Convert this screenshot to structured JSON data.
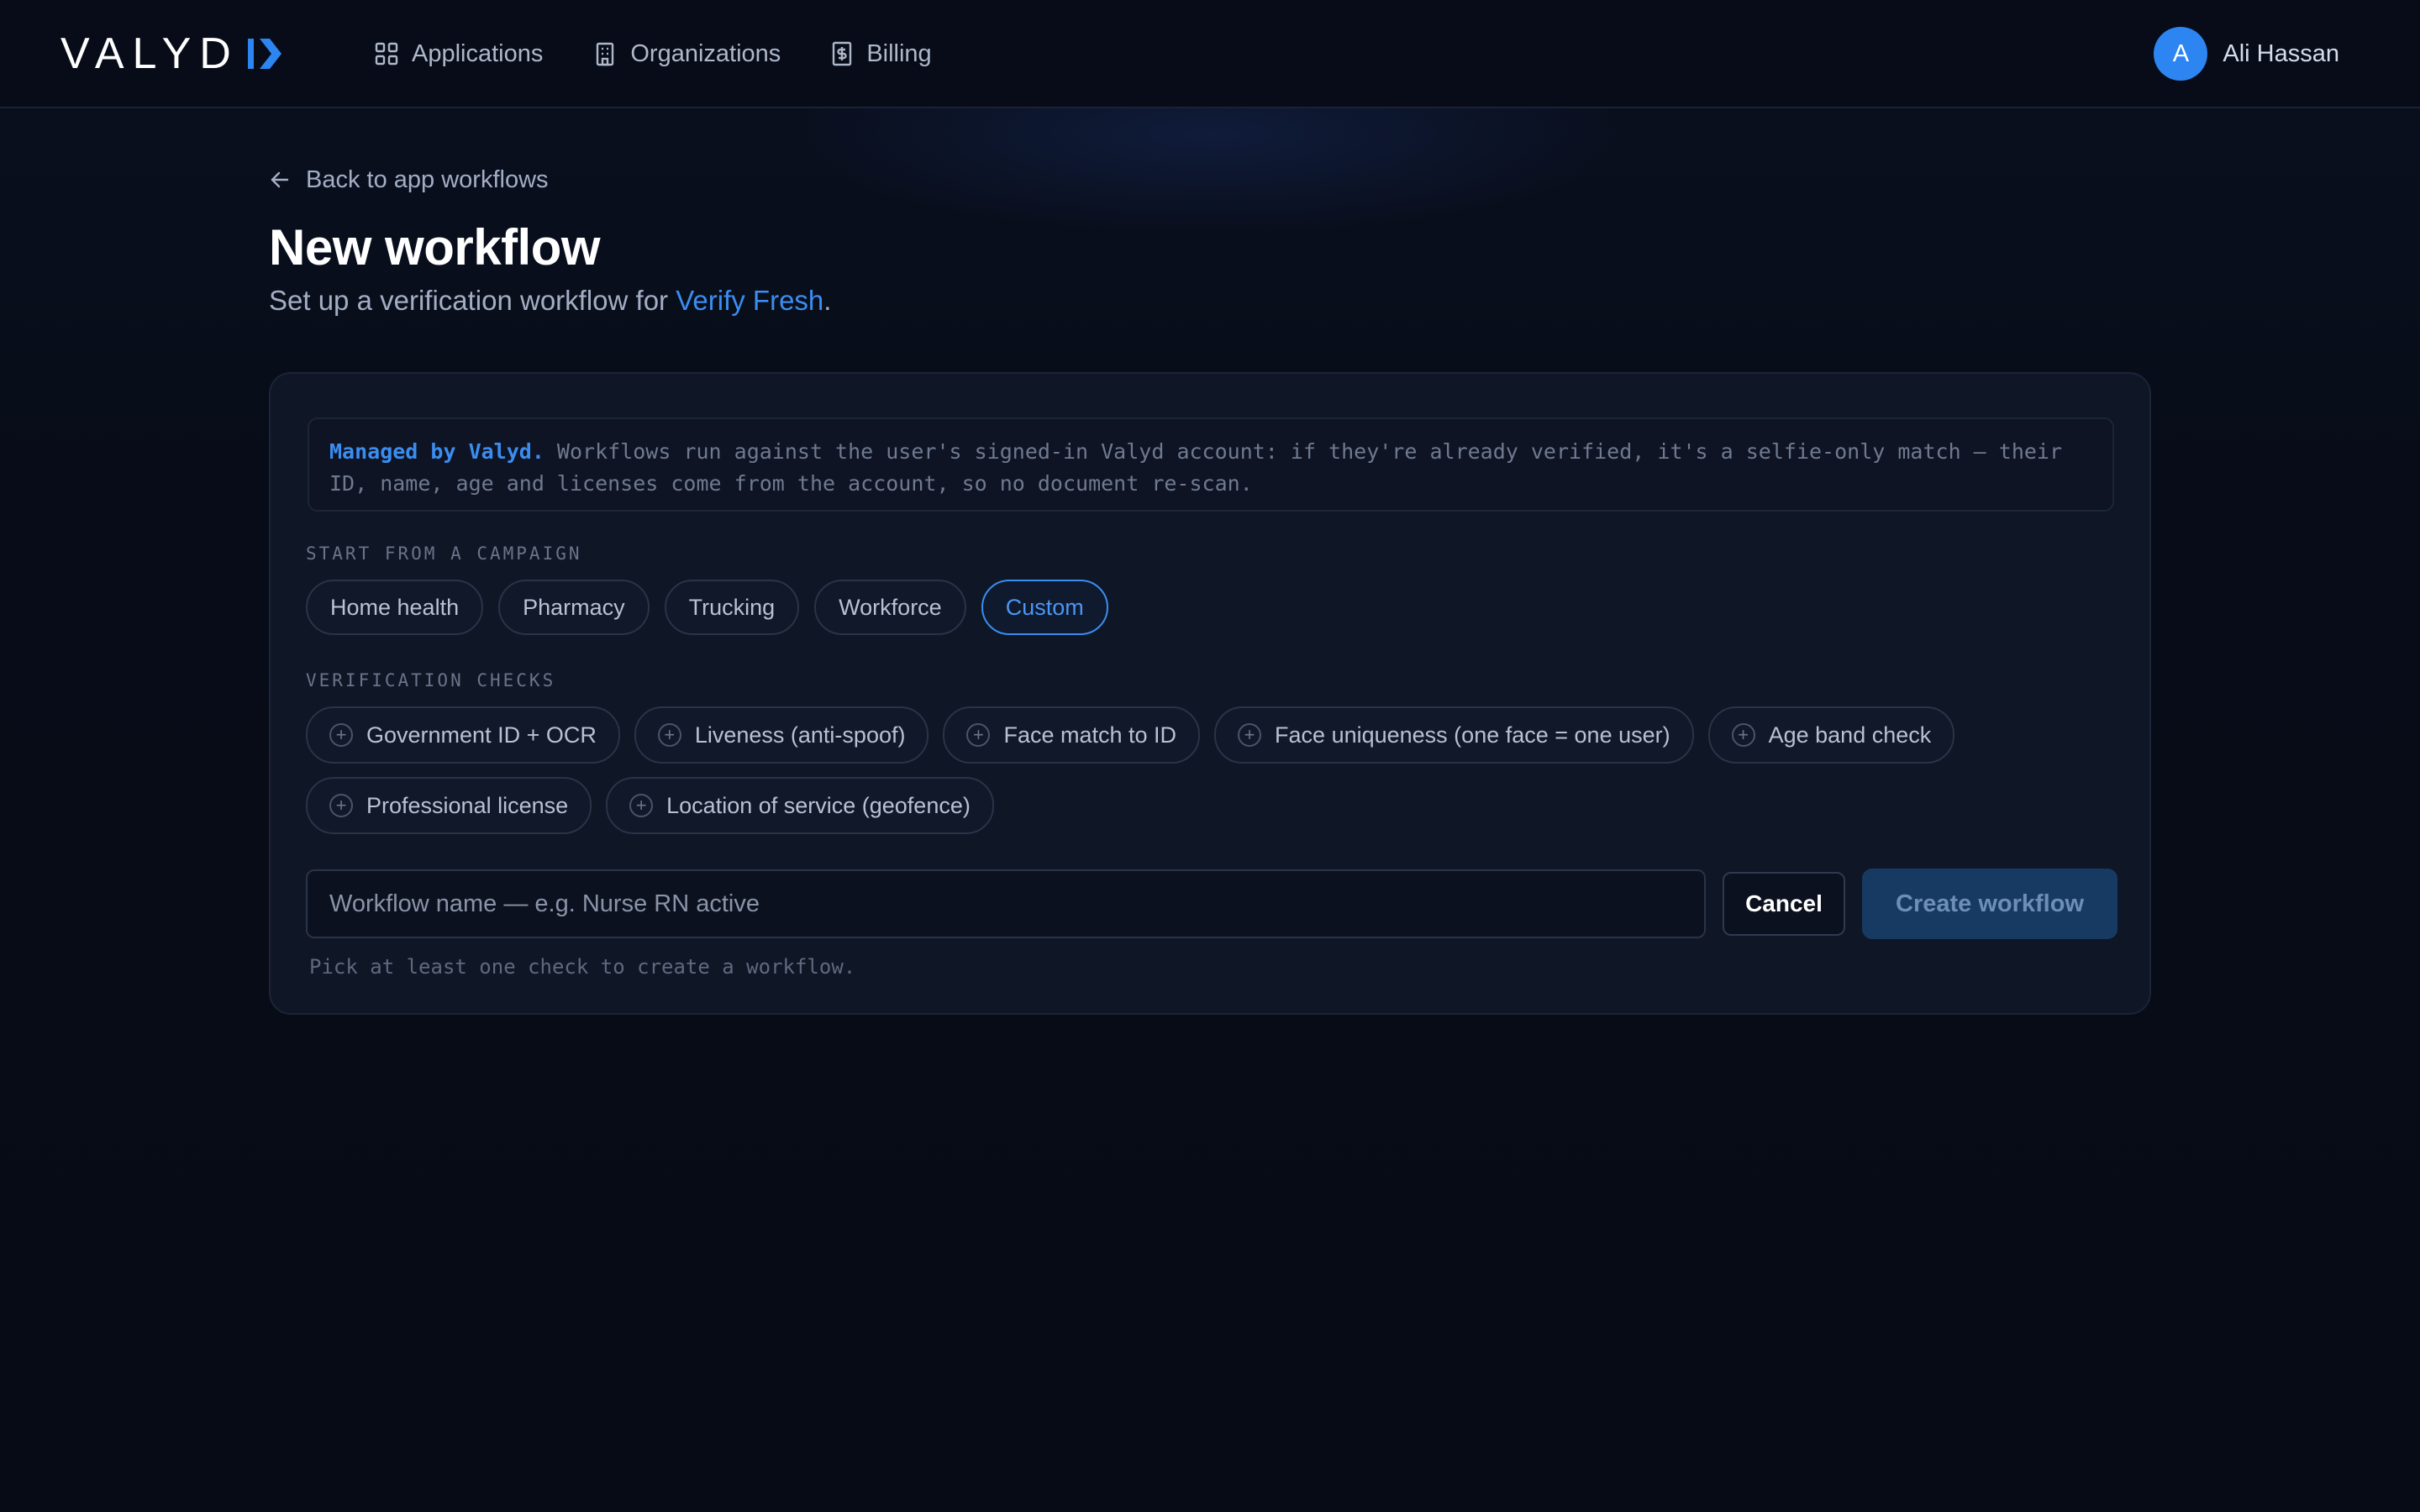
{
  "navbar": {
    "logo_text": "VALYD",
    "links": [
      {
        "label": "Applications",
        "icon": "grid-icon"
      },
      {
        "label": "Organizations",
        "icon": "building-icon"
      },
      {
        "label": "Billing",
        "icon": "receipt-dollar-icon"
      }
    ],
    "user": {
      "initial": "A",
      "name": "Ali Hassan"
    }
  },
  "header": {
    "back_label": "Back to app workflows",
    "title": "New workflow",
    "subtitle_prefix": "Set up a verification workflow for ",
    "subtitle_app": "Verify Fresh",
    "subtitle_suffix": "."
  },
  "notice": {
    "strong": "Managed by Valyd.",
    "text": " Workflows run against the user's signed-in Valyd account: if they're already verified, it's a selfie-only match — their ID, name, age and licenses come from the account, so no document re-scan."
  },
  "campaigns": {
    "label": "START FROM A CAMPAIGN",
    "items": [
      "Home health",
      "Pharmacy",
      "Trucking",
      "Workforce",
      "Custom"
    ],
    "selected": "Custom"
  },
  "checks": {
    "label": "VERIFICATION CHECKS",
    "items": [
      "Government ID + OCR",
      "Liveness (anti-spoof)",
      "Face match to ID",
      "Face uniqueness (one face = one user)",
      "Age band check",
      "Professional license",
      "Location of service (geofence)"
    ]
  },
  "form": {
    "name_placeholder": "Workflow name — e.g. Nurse RN active",
    "name_value": "",
    "cancel_label": "Cancel",
    "create_label": "Create workflow",
    "hint": "Pick at least one check to create a workflow."
  },
  "colors": {
    "accent": "#3b8df0",
    "background": "#070b15",
    "card": "#0f1626",
    "create_button": "#173a63"
  }
}
